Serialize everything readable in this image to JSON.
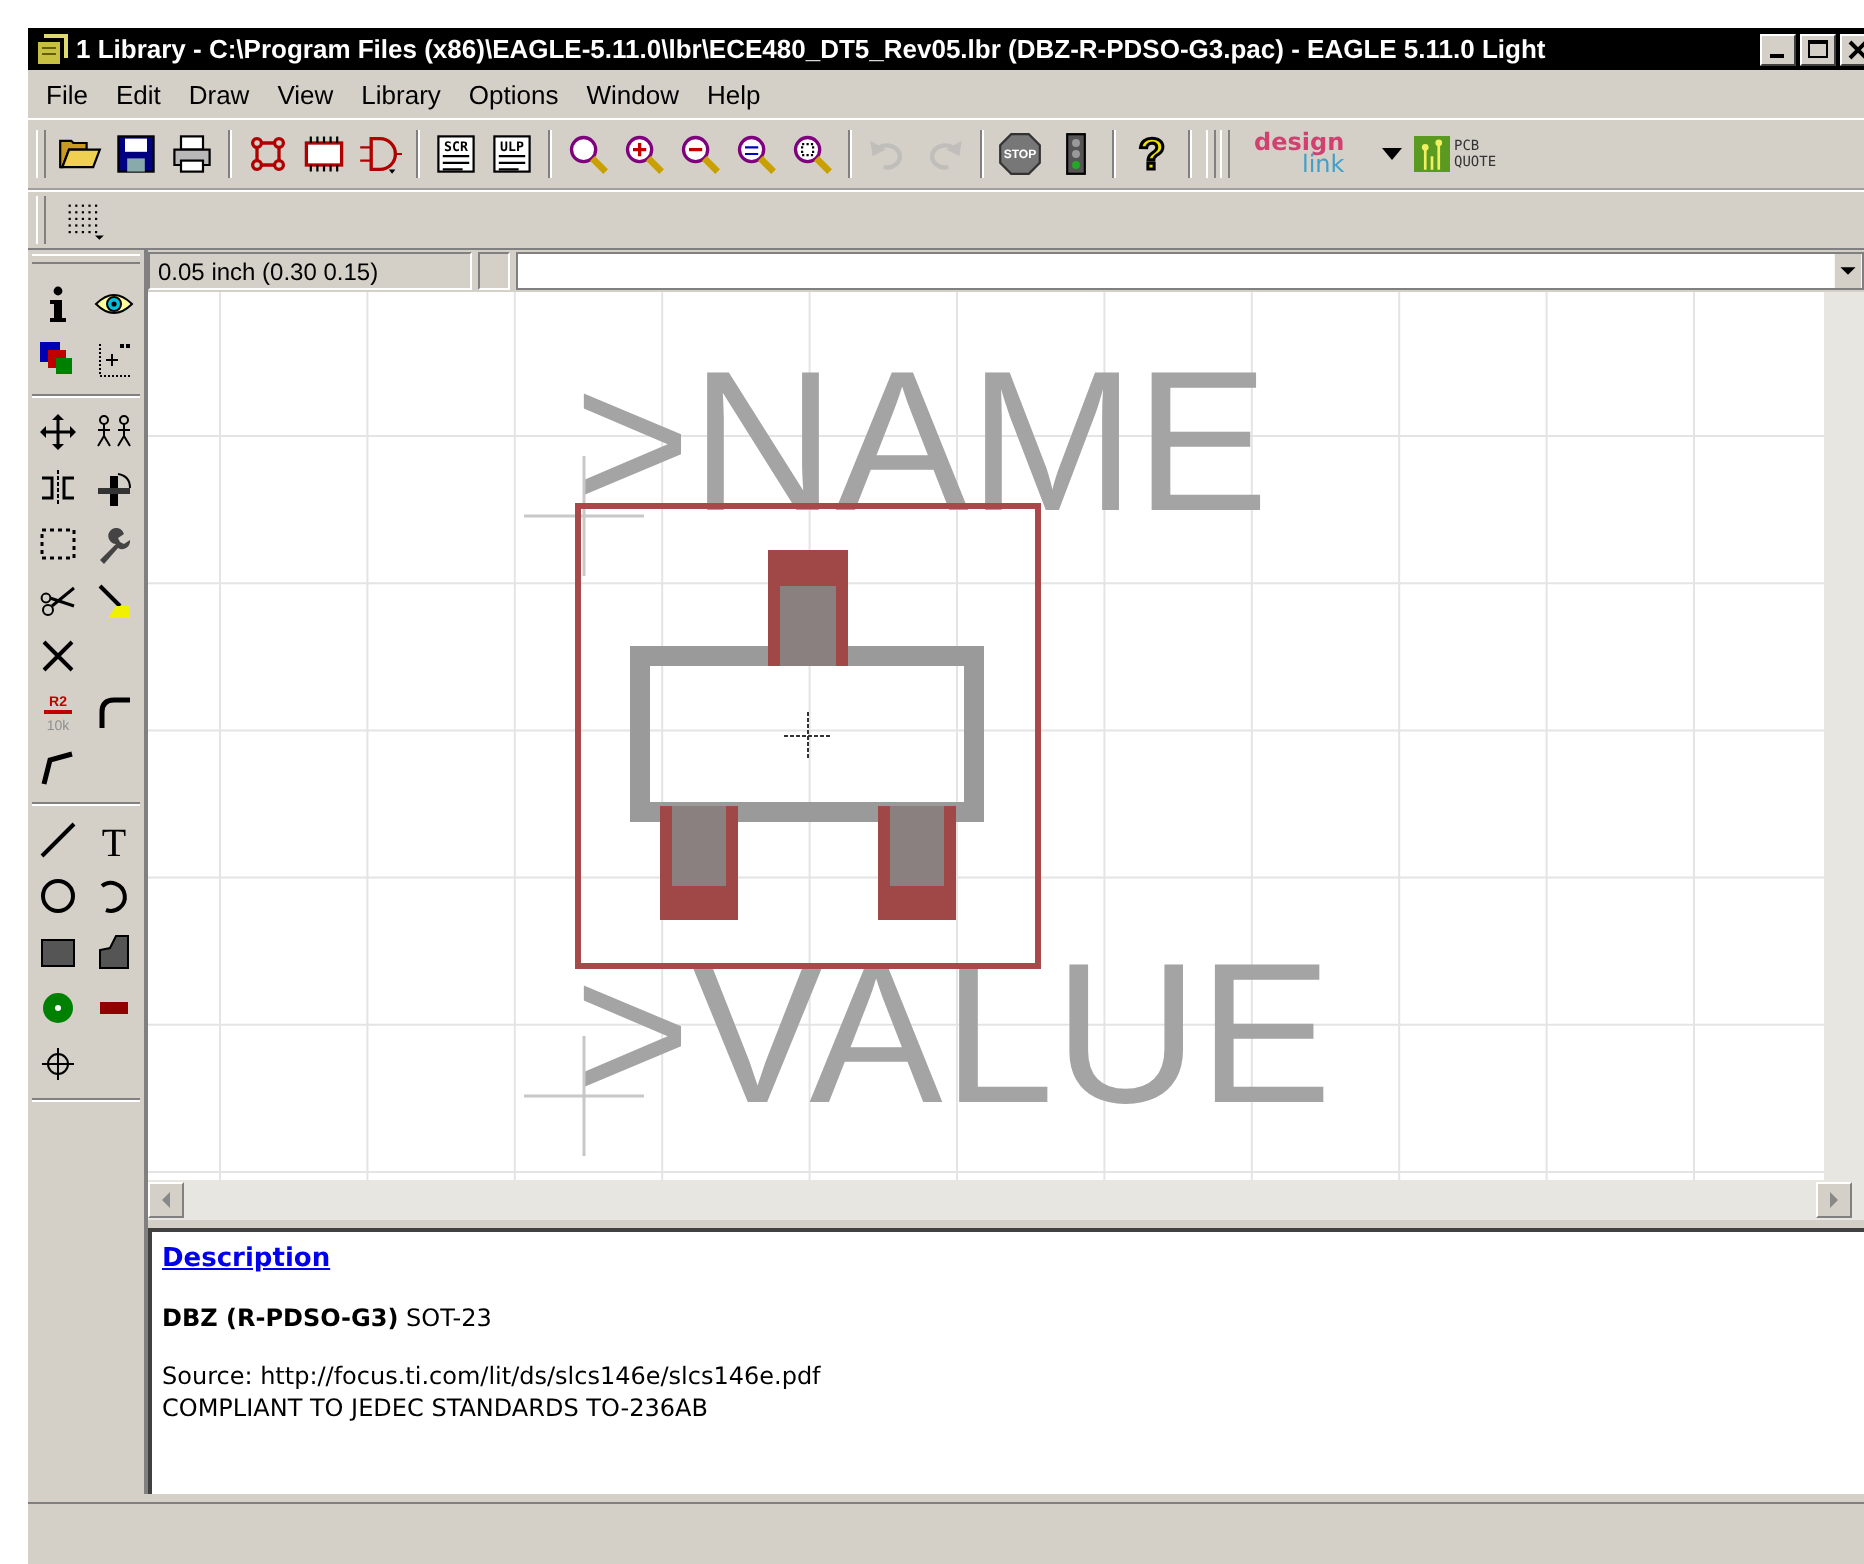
{
  "window": {
    "title": "1 Library - C:\\Program Files (x86)\\EAGLE-5.11.0\\lbr\\ECE480_DT5_Rev05.lbr (DBZ-R-PDSO-G3.pac) - EAGLE 5.11.0 Light"
  },
  "menu": [
    "File",
    "Edit",
    "Draw",
    "View",
    "Library",
    "Options",
    "Window",
    "Help"
  ],
  "toolbar": [
    [
      {
        "kind": "open",
        "disabled": false
      },
      {
        "kind": "save",
        "disabled": false
      },
      {
        "kind": "print",
        "disabled": false
      }
    ],
    [
      {
        "kind": "board",
        "disabled": false
      },
      {
        "kind": "chip",
        "disabled": false
      },
      {
        "kind": "gate",
        "disabled": false
      }
    ],
    [
      {
        "kind": "script",
        "label": "SCR",
        "disabled": false
      },
      {
        "kind": "ulp",
        "label": "ULP",
        "disabled": false
      }
    ],
    [
      {
        "kind": "zoom-fit",
        "disabled": false
      },
      {
        "kind": "zoom-in",
        "disabled": false
      },
      {
        "kind": "zoom-out",
        "disabled": false
      },
      {
        "kind": "zoom-redraw",
        "disabled": false
      },
      {
        "kind": "zoom-select",
        "disabled": false
      }
    ],
    [
      {
        "kind": "undo",
        "disabled": true
      },
      {
        "kind": "redo",
        "disabled": true
      }
    ],
    [
      {
        "kind": "stop",
        "label": "STOP",
        "disabled": false
      },
      {
        "kind": "go",
        "disabled": false
      }
    ],
    [
      {
        "kind": "help",
        "label": "?",
        "disabled": false
      }
    ]
  ],
  "logos": {
    "design_link": [
      "design",
      "link"
    ],
    "pcb_quote": [
      "PCB",
      "QUOTE"
    ]
  },
  "toolbox": [
    [
      [
        {
          "kind": "info"
        },
        {
          "kind": "display"
        }
      ],
      [
        {
          "kind": "layers"
        },
        {
          "kind": "mark"
        }
      ]
    ],
    [
      [
        {
          "kind": "move"
        },
        {
          "kind": "copy"
        }
      ],
      [
        {
          "kind": "mirror"
        },
        {
          "kind": "rotate"
        }
      ],
      [
        {
          "kind": "group"
        },
        {
          "kind": "change"
        }
      ],
      [
        {
          "kind": "cut"
        },
        {
          "kind": "paste"
        }
      ],
      [
        {
          "kind": "delete"
        }
      ],
      [
        {
          "kind": "value",
          "label": "R2",
          "sublabel": "10k"
        },
        {
          "kind": "miter"
        }
      ],
      [
        {
          "kind": "split"
        }
      ]
    ],
    [
      [
        {
          "kind": "wire"
        },
        {
          "kind": "text",
          "label": "T"
        }
      ],
      [
        {
          "kind": "circle"
        },
        {
          "kind": "arc"
        }
      ],
      [
        {
          "kind": "rect"
        },
        {
          "kind": "polygon"
        }
      ],
      [
        {
          "kind": "pad"
        },
        {
          "kind": "smd"
        }
      ],
      [
        {
          "kind": "hole"
        }
      ]
    ]
  ],
  "coordinates": "0.05 inch (0.30 0.15)",
  "canvas": {
    "name_text": ">NAME",
    "value_text": ">VALUE"
  },
  "description": {
    "link": "Description",
    "title": "**DBZ (R-PDSO-G3)** SOT-23",
    "lines": [
      "Source: http://focus.ti.com/lit/ds/slcs146e/slcs146e.pdf",
      "COMPLIANT TO JEDEC STANDARDS TO-236AB"
    ]
  }
}
